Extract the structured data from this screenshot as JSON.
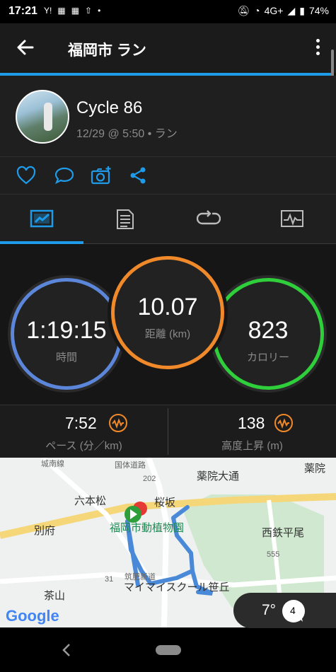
{
  "status_bar": {
    "time": "17:21",
    "network": "4G+",
    "battery": "74%",
    "icons": [
      "y-news-icon",
      "notification-icon",
      "notification-icon",
      "upload-icon",
      "dot-icon",
      "mute-icon",
      "wifi-icon",
      "signal-icon",
      "battery-icon"
    ]
  },
  "app_bar": {
    "title": "福岡市 ラン",
    "back_icon": "arrow-left-icon",
    "menu_icon": "more-vertical-icon"
  },
  "activity": {
    "name": "Cycle 86",
    "meta": "12/29 @ 5:50 • ラン"
  },
  "actions": [
    "heart-icon",
    "comment-icon",
    "camera-add-icon",
    "share-icon"
  ],
  "tabs": [
    {
      "icon": "stats-chart-icon",
      "selected": true
    },
    {
      "icon": "document-icon",
      "selected": false
    },
    {
      "icon": "laps-icon",
      "selected": false
    },
    {
      "icon": "graph-icon",
      "selected": false
    }
  ],
  "stats": {
    "time": {
      "value": "1:19:15",
      "label": "時間"
    },
    "distance": {
      "value": "10.07",
      "label": "距離 (km)"
    },
    "calories": {
      "value": "823",
      "label": "カロリー"
    }
  },
  "metrics": {
    "pace": {
      "value": "7:52",
      "label": "ペース (分／km)"
    },
    "elevation": {
      "value": "138",
      "label": "高度上昇 (m)"
    }
  },
  "map": {
    "labels": {
      "yakuin_odori": "薬院大通",
      "yakuin": "薬院",
      "roppon_matsu": "六本松",
      "sakurazaka": "桜坂",
      "zoo": "福岡市動植物園",
      "nishitetsu_hirao": "西鉄平尾",
      "befu": "別府",
      "chayama": "茶山",
      "school": "マイマイスクール笹丘",
      "road_202": "202",
      "road_555": "555",
      "road_31": "31",
      "ward": "城南線",
      "route": "国体道路",
      "chikuhi": "筑肥新道",
      "google": "Google"
    }
  },
  "weather": {
    "temperature": "7°",
    "wind": "4"
  },
  "colors": {
    "accent": "#1e9be9",
    "time_ring": "#5b86d9",
    "distance_ring": "#f0892a",
    "calories_ring": "#2fcf3b"
  }
}
